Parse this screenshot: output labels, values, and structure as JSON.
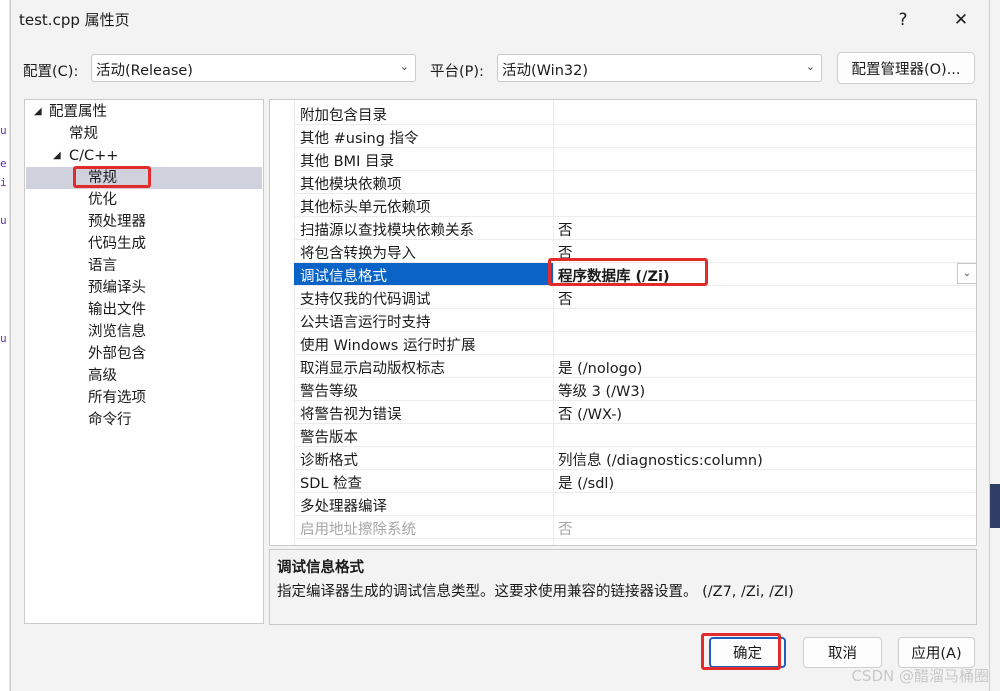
{
  "window": {
    "title": "test.cpp 属性页",
    "help_glyph": "?",
    "close_glyph": "✕"
  },
  "config": {
    "config_label": "配置(C):",
    "config_value": "活动(Release)",
    "platform_label": "平台(P):",
    "platform_value": "活动(Win32)",
    "manager_button": "配置管理器(O)..."
  },
  "tree": {
    "root": "配置属性",
    "general": "常规",
    "cpp": "C/C++",
    "children": [
      "常规",
      "优化",
      "预处理器",
      "代码生成",
      "语言",
      "预编译头",
      "输出文件",
      "浏览信息",
      "外部包含",
      "高级",
      "所有选项",
      "命令行"
    ]
  },
  "grid": {
    "rows": [
      {
        "name": "附加包含目录",
        "value": ""
      },
      {
        "name": "其他 #using 指令",
        "value": ""
      },
      {
        "name": "其他 BMI 目录",
        "value": ""
      },
      {
        "name": "其他模块依赖项",
        "value": ""
      },
      {
        "name": "其他标头单元依赖项",
        "value": ""
      },
      {
        "name": "扫描源以查找模块依赖关系",
        "value": "否"
      },
      {
        "name": "将包含转换为导入",
        "value": "否"
      },
      {
        "name": "调试信息格式",
        "value": "程序数据库 (/Zi)"
      },
      {
        "name": "支持仅我的代码调试",
        "value": "否"
      },
      {
        "name": "公共语言运行时支持",
        "value": ""
      },
      {
        "name": "使用 Windows 运行时扩展",
        "value": ""
      },
      {
        "name": "取消显示启动版权标志",
        "value": "是 (/nologo)"
      },
      {
        "name": "警告等级",
        "value": "等级 3 (/W3)"
      },
      {
        "name": "将警告视为错误",
        "value": "否 (/WX-)"
      },
      {
        "name": "警告版本",
        "value": ""
      },
      {
        "name": "诊断格式",
        "value": "列信息 (/diagnostics:column)"
      },
      {
        "name": "SDL 检查",
        "value": "是 (/sdl)"
      },
      {
        "name": "多处理器编译",
        "value": ""
      },
      {
        "name": "启用地址擦除系统",
        "value": "否"
      }
    ]
  },
  "description": {
    "title": "调试信息格式",
    "text": "指定编译器生成的调试信息类型。这要求使用兼容的链接器设置。  (/Z7, /Zi, /ZI)"
  },
  "buttons": {
    "ok": "确定",
    "cancel": "取消",
    "apply": "应用(A)"
  },
  "watermark": "CSDN @醋溜马桶圈",
  "colors": {
    "selection": "#0a63c7",
    "highlight_box": "#e22b2b",
    "tree_selection": "#cfd2dc"
  }
}
